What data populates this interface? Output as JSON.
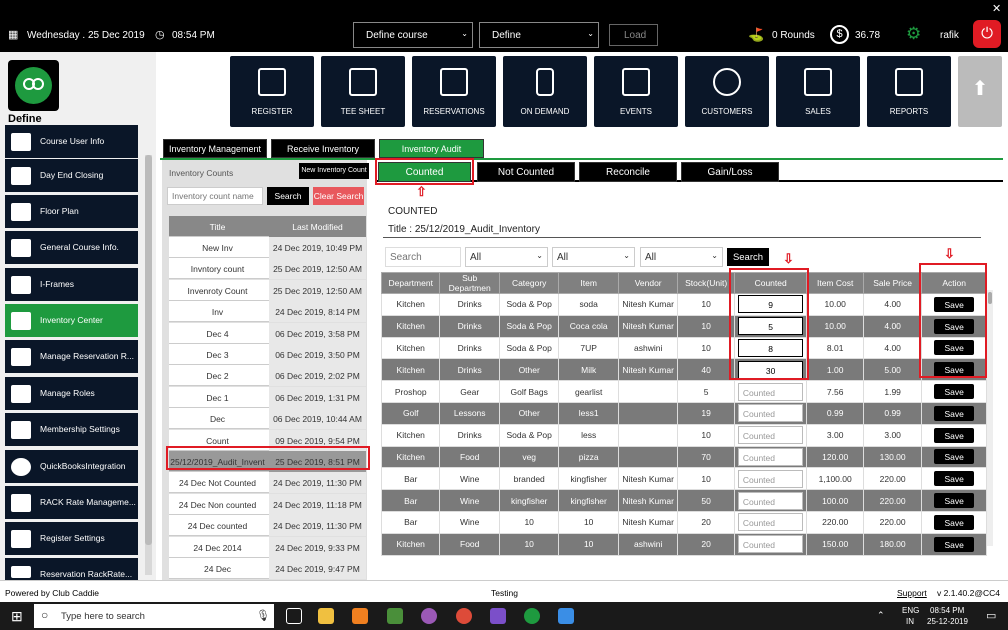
{
  "topbar": {
    "date": "Wednesday . 25 Dec 2019",
    "time": "08:54 PM",
    "course_select": "Define  course",
    "define_select": "Define",
    "load_button": "Load",
    "rounds": "0 Rounds",
    "balance": "36.78",
    "user": "rafik"
  },
  "brand": {
    "label": "Define"
  },
  "nav": [
    "REGISTER",
    "TEE SHEET",
    "RESERVATIONS",
    "ON DEMAND",
    "EVENTS",
    "CUSTOMERS",
    "SALES",
    "REPORTS"
  ],
  "sidebar": [
    "Course User Info",
    "Day End Closing",
    "Floor Plan",
    "General Course Info.",
    "I-Frames",
    "Inventory Center",
    "Manage Reservation R...",
    "Manage Roles",
    "Membership Settings",
    "QuickBooksIntegration",
    "RACK Rate Manageme...",
    "Register Settings",
    "Reservation RackRate..."
  ],
  "main_tabs": [
    "Inventory Management",
    "Receive Inventory",
    "Inventory Audit"
  ],
  "left": {
    "heading": "Inventory Counts",
    "new_button": "New Inventory Count",
    "search_placeholder": "Inventory count name",
    "search_button": "Search",
    "clear_button": "Clear Search",
    "columns": [
      "Title",
      "Last Modified"
    ],
    "rows": [
      [
        "New Inv",
        "24 Dec 2019, 10:49 PM"
      ],
      [
        "Invntory count",
        "25 Dec 2019, 12:50 AM"
      ],
      [
        "Invenroty Count",
        "25 Dec 2019, 12:50 AM"
      ],
      [
        "Inv",
        "24 Dec 2019, 8:14 PM"
      ],
      [
        "Dec 4",
        "06 Dec 2019, 3:58 PM"
      ],
      [
        "Dec 3",
        "06 Dec 2019, 3:50 PM"
      ],
      [
        "Dec 2",
        "06 Dec 2019, 2:02 PM"
      ],
      [
        "Dec 1",
        "06 Dec 2019, 1:31 PM"
      ],
      [
        "Dec",
        "06 Dec 2019, 10:44 AM"
      ],
      [
        "Count",
        "09 Dec 2019, 9:54 PM"
      ],
      [
        "25/12/2019_Audit_Invent",
        "25 Dec 2019, 8:51 PM"
      ],
      [
        "24 Dec Not Counted",
        "24 Dec 2019, 11:30 PM"
      ],
      [
        "24 Dec Non counted",
        "24 Dec 2019, 11:18 PM"
      ],
      [
        "24 Dec counted",
        "24 Dec 2019, 11:30 PM"
      ],
      [
        "24 Dec 2014",
        "24 Dec 2019, 9:33 PM"
      ],
      [
        "24 Dec",
        "24 Dec 2019, 9:47 PM"
      ]
    ]
  },
  "sub_tabs": [
    "Counted",
    "Not Counted",
    "Reconcile",
    "Gain/Loss"
  ],
  "audit": {
    "status": "COUNTED",
    "title": "Title : 25/12/2019_Audit_Inventory",
    "search_placeholder": "Search",
    "filters": [
      "All",
      "All",
      "All"
    ],
    "search_button": "Search",
    "columns": [
      "Department",
      "Sub Departmen",
      "Category",
      "Item",
      "Vendor",
      "Stock(Unit)",
      "Counted",
      "Item Cost",
      "Sale Price",
      "Action"
    ],
    "count_placeholder": "Counted",
    "save_label": "Save",
    "rows": [
      {
        "dept": "Kitchen",
        "sub": "Drinks",
        "cat": "Soda & Pop",
        "item": "soda",
        "vendor": "Nitesh Kumar",
        "stock": "10",
        "counted": "9",
        "cost": "10.00",
        "price": "4.00"
      },
      {
        "dept": "Kitchen",
        "sub": "Drinks",
        "cat": "Soda & Pop",
        "item": "Coca cola",
        "vendor": "Nitesh Kumar",
        "stock": "10",
        "counted": "5",
        "cost": "10.00",
        "price": "4.00"
      },
      {
        "dept": "Kitchen",
        "sub": "Drinks",
        "cat": "Soda & Pop",
        "item": "7UP",
        "vendor": "ashwini",
        "stock": "10",
        "counted": "8",
        "cost": "8.01",
        "price": "4.00"
      },
      {
        "dept": "Kitchen",
        "sub": "Drinks",
        "cat": "Other",
        "item": "Milk",
        "vendor": "Nitesh Kumar",
        "stock": "40",
        "counted": "30",
        "cost": "1.00",
        "price": "5.00"
      },
      {
        "dept": "Proshop",
        "sub": "Gear",
        "cat": "Golf Bags",
        "item": "gearlist",
        "vendor": "",
        "stock": "5",
        "counted": "",
        "cost": "7.56",
        "price": "1.99"
      },
      {
        "dept": "Golf",
        "sub": "Lessons",
        "cat": "Other",
        "item": "less1",
        "vendor": "",
        "stock": "19",
        "counted": "",
        "cost": "0.99",
        "price": "0.99"
      },
      {
        "dept": "Kitchen",
        "sub": "Drinks",
        "cat": "Soda & Pop",
        "item": "less",
        "vendor": "",
        "stock": "10",
        "counted": "",
        "cost": "3.00",
        "price": "3.00"
      },
      {
        "dept": "Kitchen",
        "sub": "Food",
        "cat": "veg",
        "item": "pizza",
        "vendor": "",
        "stock": "70",
        "counted": "",
        "cost": "120.00",
        "price": "130.00"
      },
      {
        "dept": "Bar",
        "sub": "Wine",
        "cat": "branded",
        "item": "kingfisher",
        "vendor": "Nitesh Kumar",
        "stock": "10",
        "counted": "",
        "cost": "1,100.00",
        "price": "220.00"
      },
      {
        "dept": "Bar",
        "sub": "Wine",
        "cat": "kingfisher",
        "item": "kingfisher",
        "vendor": "Nitesh Kumar",
        "stock": "50",
        "counted": "",
        "cost": "100.00",
        "price": "220.00"
      },
      {
        "dept": "Bar",
        "sub": "Wine",
        "cat": "10",
        "item": "10",
        "vendor": "Nitesh Kumar",
        "stock": "20",
        "counted": "",
        "cost": "220.00",
        "price": "220.00"
      },
      {
        "dept": "Kitchen",
        "sub": "Food",
        "cat": "10",
        "item": "10",
        "vendor": "ashwini",
        "stock": "20",
        "counted": "",
        "cost": "150.00",
        "price": "180.00"
      }
    ]
  },
  "footer": {
    "powered": "Powered by Club Caddie",
    "env": "Testing",
    "support": "Support",
    "version": "v 2.1.40.2@CC4"
  },
  "taskbar": {
    "search_placeholder": "Type here to search",
    "lang1": "ENG",
    "lang2": "IN",
    "time": "08:54 PM",
    "date": "25-12-2019"
  },
  "colors": {
    "accent": "#1e9a3f",
    "nav_bg": "#0a1628",
    "highlight": "#e01b24"
  }
}
